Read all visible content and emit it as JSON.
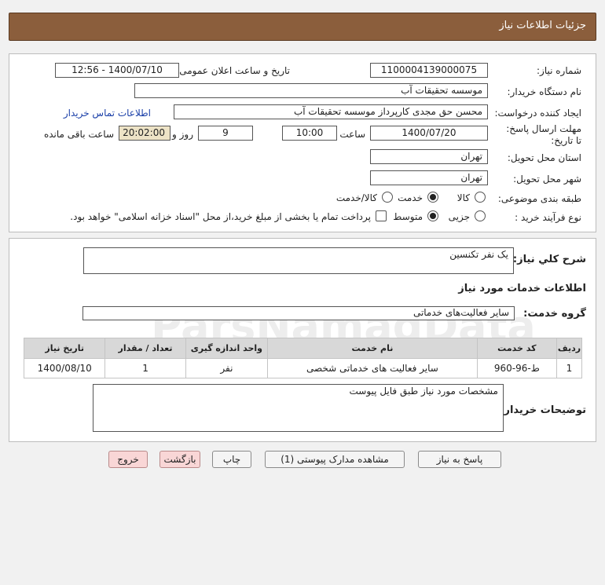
{
  "header": {
    "title": "جزئیات اطلاعات نیاز"
  },
  "info": {
    "need_number_label": "شماره نیاز:",
    "need_number": "1100004139000075",
    "announce_label": "تاریخ و ساعت اعلان عمومی:",
    "announce_value": "1400/07/10 - 12:56",
    "buyer_org_label": "نام دستگاه خریدار:",
    "buyer_org": "موسسه تحقیقات آب",
    "creator_label": "ایجاد کننده درخواست:",
    "creator": "محسن حق مجدی کارپرداز موسسه تحقیقات آب",
    "contact_link": "اطلاعات تماس خریدار",
    "deadline_label": "مهلت ارسال پاسخ: تا تاریخ:",
    "deadline_date": "1400/07/20",
    "time_label": "ساعت",
    "deadline_time": "10:00",
    "days_value": "9",
    "days_label": "روز و",
    "remaining_time": "20:02:00",
    "remaining_label": "ساعت باقی مانده",
    "province_label": "استان محل تحویل:",
    "province": "تهران",
    "city_label": "شهر محل تحویل:",
    "city": "تهران",
    "category_label": "طبقه بندی موضوعی:",
    "category_options": [
      "کالا",
      "خدمت",
      "کالا/خدمت"
    ],
    "category_selected": "خدمت",
    "purchase_type_label": "نوع فرآیند خرید :",
    "purchase_options": [
      "جزیی",
      "متوسط"
    ],
    "purchase_selected": "متوسط",
    "payment_note": "پرداخت تمام یا بخشی از مبلغ خرید،از محل \"اسناد خزانه اسلامی\" خواهد بود."
  },
  "details": {
    "general_desc_label": "شرح کلي نياز:",
    "general_desc": "یک نفر تکنسین",
    "services_info_title": "اطلاعات خدمات مورد نیاز",
    "service_group_label": "گروه خدمت:",
    "service_group": "سایر فعالیت‌های خدماتی",
    "table": {
      "headers": [
        "ردیف",
        "کد خدمت",
        "نام خدمت",
        "واحد اندازه گیری",
        "تعداد / مقدار",
        "تاریخ نیاز"
      ],
      "rows": [
        [
          "1",
          "ط-96-960",
          "سایر فعالیت های خدماتی شخصی",
          "نفر",
          "1",
          "1400/08/10"
        ]
      ]
    },
    "buyer_notes_label": "توضیحات خریدار:",
    "buyer_notes": "مشخصات مورد نیاز طبق فایل پیوست"
  },
  "buttons": {
    "reply": "پاسخ به نیاز",
    "view_docs": "مشاهده مدارک پیوستی (1)",
    "print": "چاپ",
    "back": "بازگشت",
    "exit": "خروج"
  }
}
